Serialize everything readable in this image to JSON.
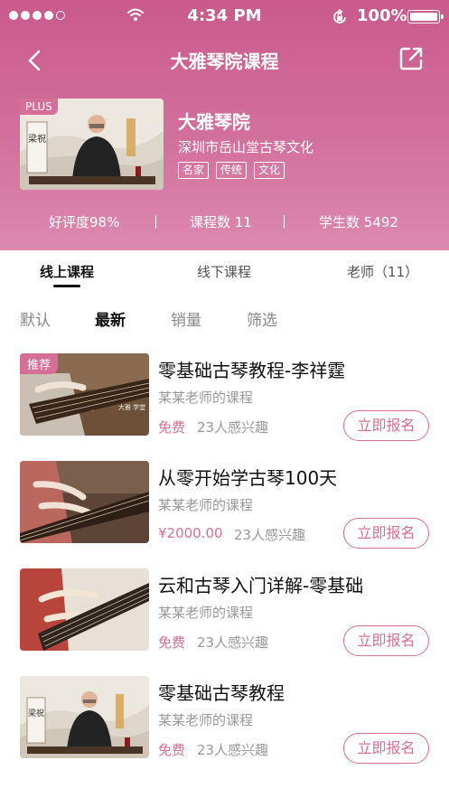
{
  "status_bar": {
    "time": "4:34 PM",
    "battery": "100%"
  },
  "nav": {
    "title": "大雅琴院课程",
    "back_icon": "chevron-left-icon",
    "share_icon": "share-icon"
  },
  "school": {
    "badge": "PLUS",
    "name": "大雅琴院",
    "subtitle": "深圳市岳山堂古琴文化",
    "tags": [
      "名家",
      "传统",
      "文化"
    ],
    "thumb_sign": "梁祝"
  },
  "stats": {
    "rating": "好评度98%",
    "courses": "课程数 11",
    "students": "学生数 5492"
  },
  "tabs": [
    "线上课程",
    "线下课程",
    "老师（11）"
  ],
  "sort_options": [
    "默认",
    "最新",
    "销量",
    "筛选"
  ],
  "courses": [
    {
      "badge": "推荐",
      "title": "零基础古琴教程-李祥霆",
      "teacher": "某某老师的课程",
      "price": "免费",
      "interest": "23人感兴趣",
      "button": "立即报名",
      "thumb_text": "大雅 学堂"
    },
    {
      "title": "从零开始学古琴100天",
      "teacher": "某某老师的课程",
      "price": "¥2000.00",
      "interest": "23人感兴趣",
      "button": "立即报名"
    },
    {
      "title": "云和古琴入门详解-零基础",
      "teacher": "某某老师的课程",
      "price": "免费",
      "interest": "23人感兴趣",
      "button": "立即报名"
    },
    {
      "title": "零基础古琴教程",
      "teacher": "某某老师的课程",
      "price": "免费",
      "interest": "23人感兴趣",
      "button": "立即报名",
      "thumb_sign": "梁祝"
    }
  ],
  "colors": {
    "accent": "#d76e98",
    "header_top": "#c95a8b",
    "header_bottom": "#dc89ad"
  }
}
